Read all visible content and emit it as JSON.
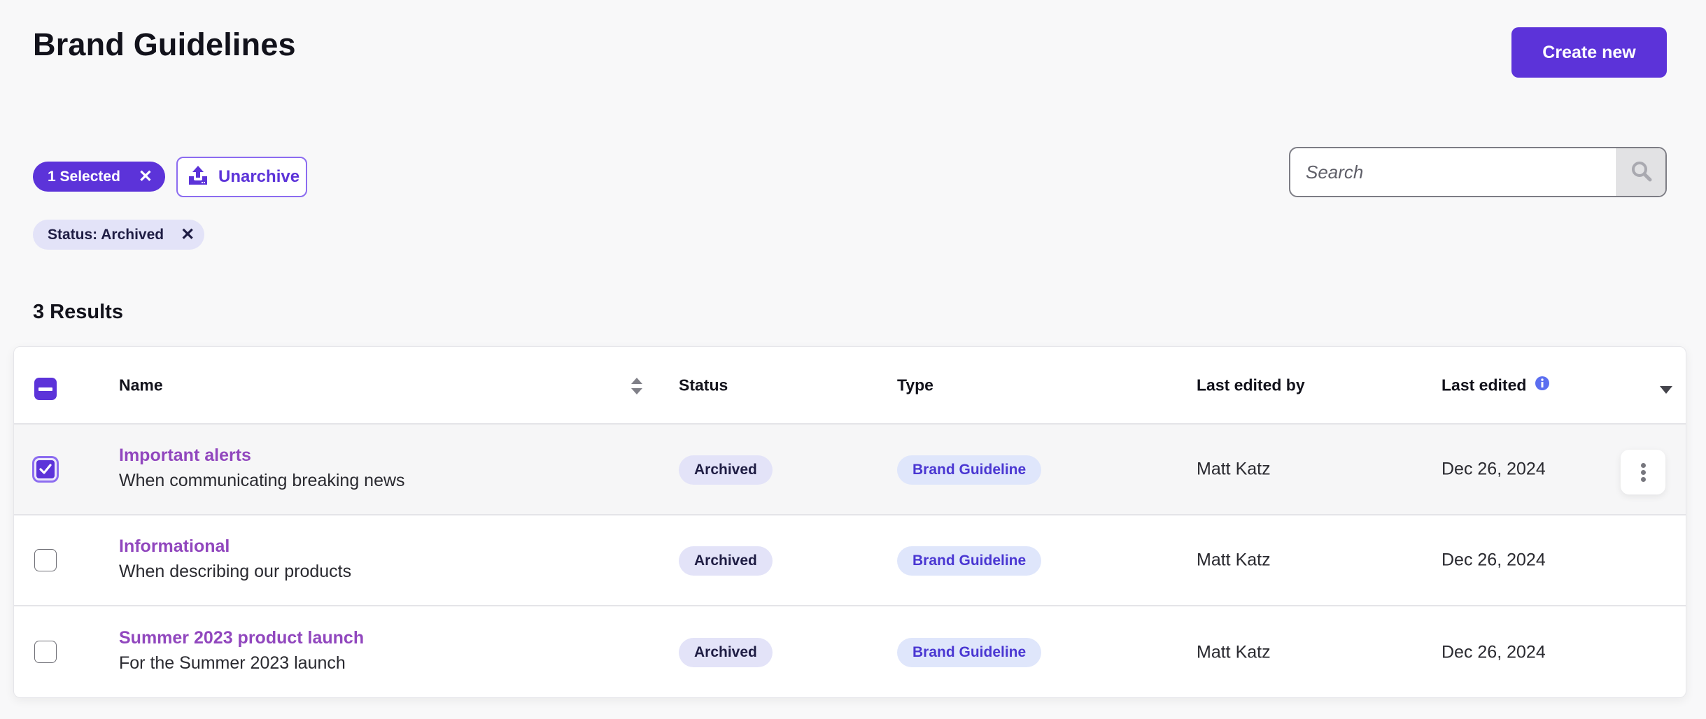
{
  "header": {
    "title": "Brand Guidelines",
    "create_label": "Create new"
  },
  "toolbar": {
    "selected_label": "1 Selected",
    "clear_selection_icon": "close-icon",
    "unarchive_label": "Unarchive",
    "unarchive_icon": "upload-icon",
    "filters": [
      {
        "label": "Status: Archived",
        "remove_icon": "close-icon"
      }
    ]
  },
  "search": {
    "placeholder": "Search",
    "value": "",
    "icon": "search-icon"
  },
  "results": {
    "count_label": "3 Results"
  },
  "table": {
    "select_all_state": "indeterminate",
    "columns": {
      "name": "Name",
      "status": "Status",
      "type": "Type",
      "last_edited_by": "Last edited by",
      "last_edited": "Last edited"
    },
    "icons": {
      "sort": "sort-icon",
      "info": "info-icon",
      "column_menu": "caret-down-icon",
      "row_menu": "kebab-menu-icon"
    },
    "rows": [
      {
        "selected": true,
        "name": "Important alerts",
        "description": "When communicating breaking news",
        "status": "Archived",
        "type": "Brand Guideline",
        "last_edited_by": "Matt Katz",
        "last_edited": "Dec 26, 2024"
      },
      {
        "selected": false,
        "name": "Informational",
        "description": "When describing our products",
        "status": "Archived",
        "type": "Brand Guideline",
        "last_edited_by": "Matt Katz",
        "last_edited": "Dec 26, 2024"
      },
      {
        "selected": false,
        "name": "Summer 2023 product launch",
        "description": "For the Summer 2023 launch",
        "status": "Archived",
        "type": "Brand Guideline",
        "last_edited_by": "Matt Katz",
        "last_edited": "Dec 26, 2024"
      }
    ]
  },
  "colors": {
    "primary": "#5c33d9",
    "link": "#9147be",
    "status_pill_bg": "#e3e3f8",
    "type_pill_bg": "#dfe6fb",
    "type_pill_text": "#4a37d2",
    "info_icon": "#5b6ef0"
  }
}
